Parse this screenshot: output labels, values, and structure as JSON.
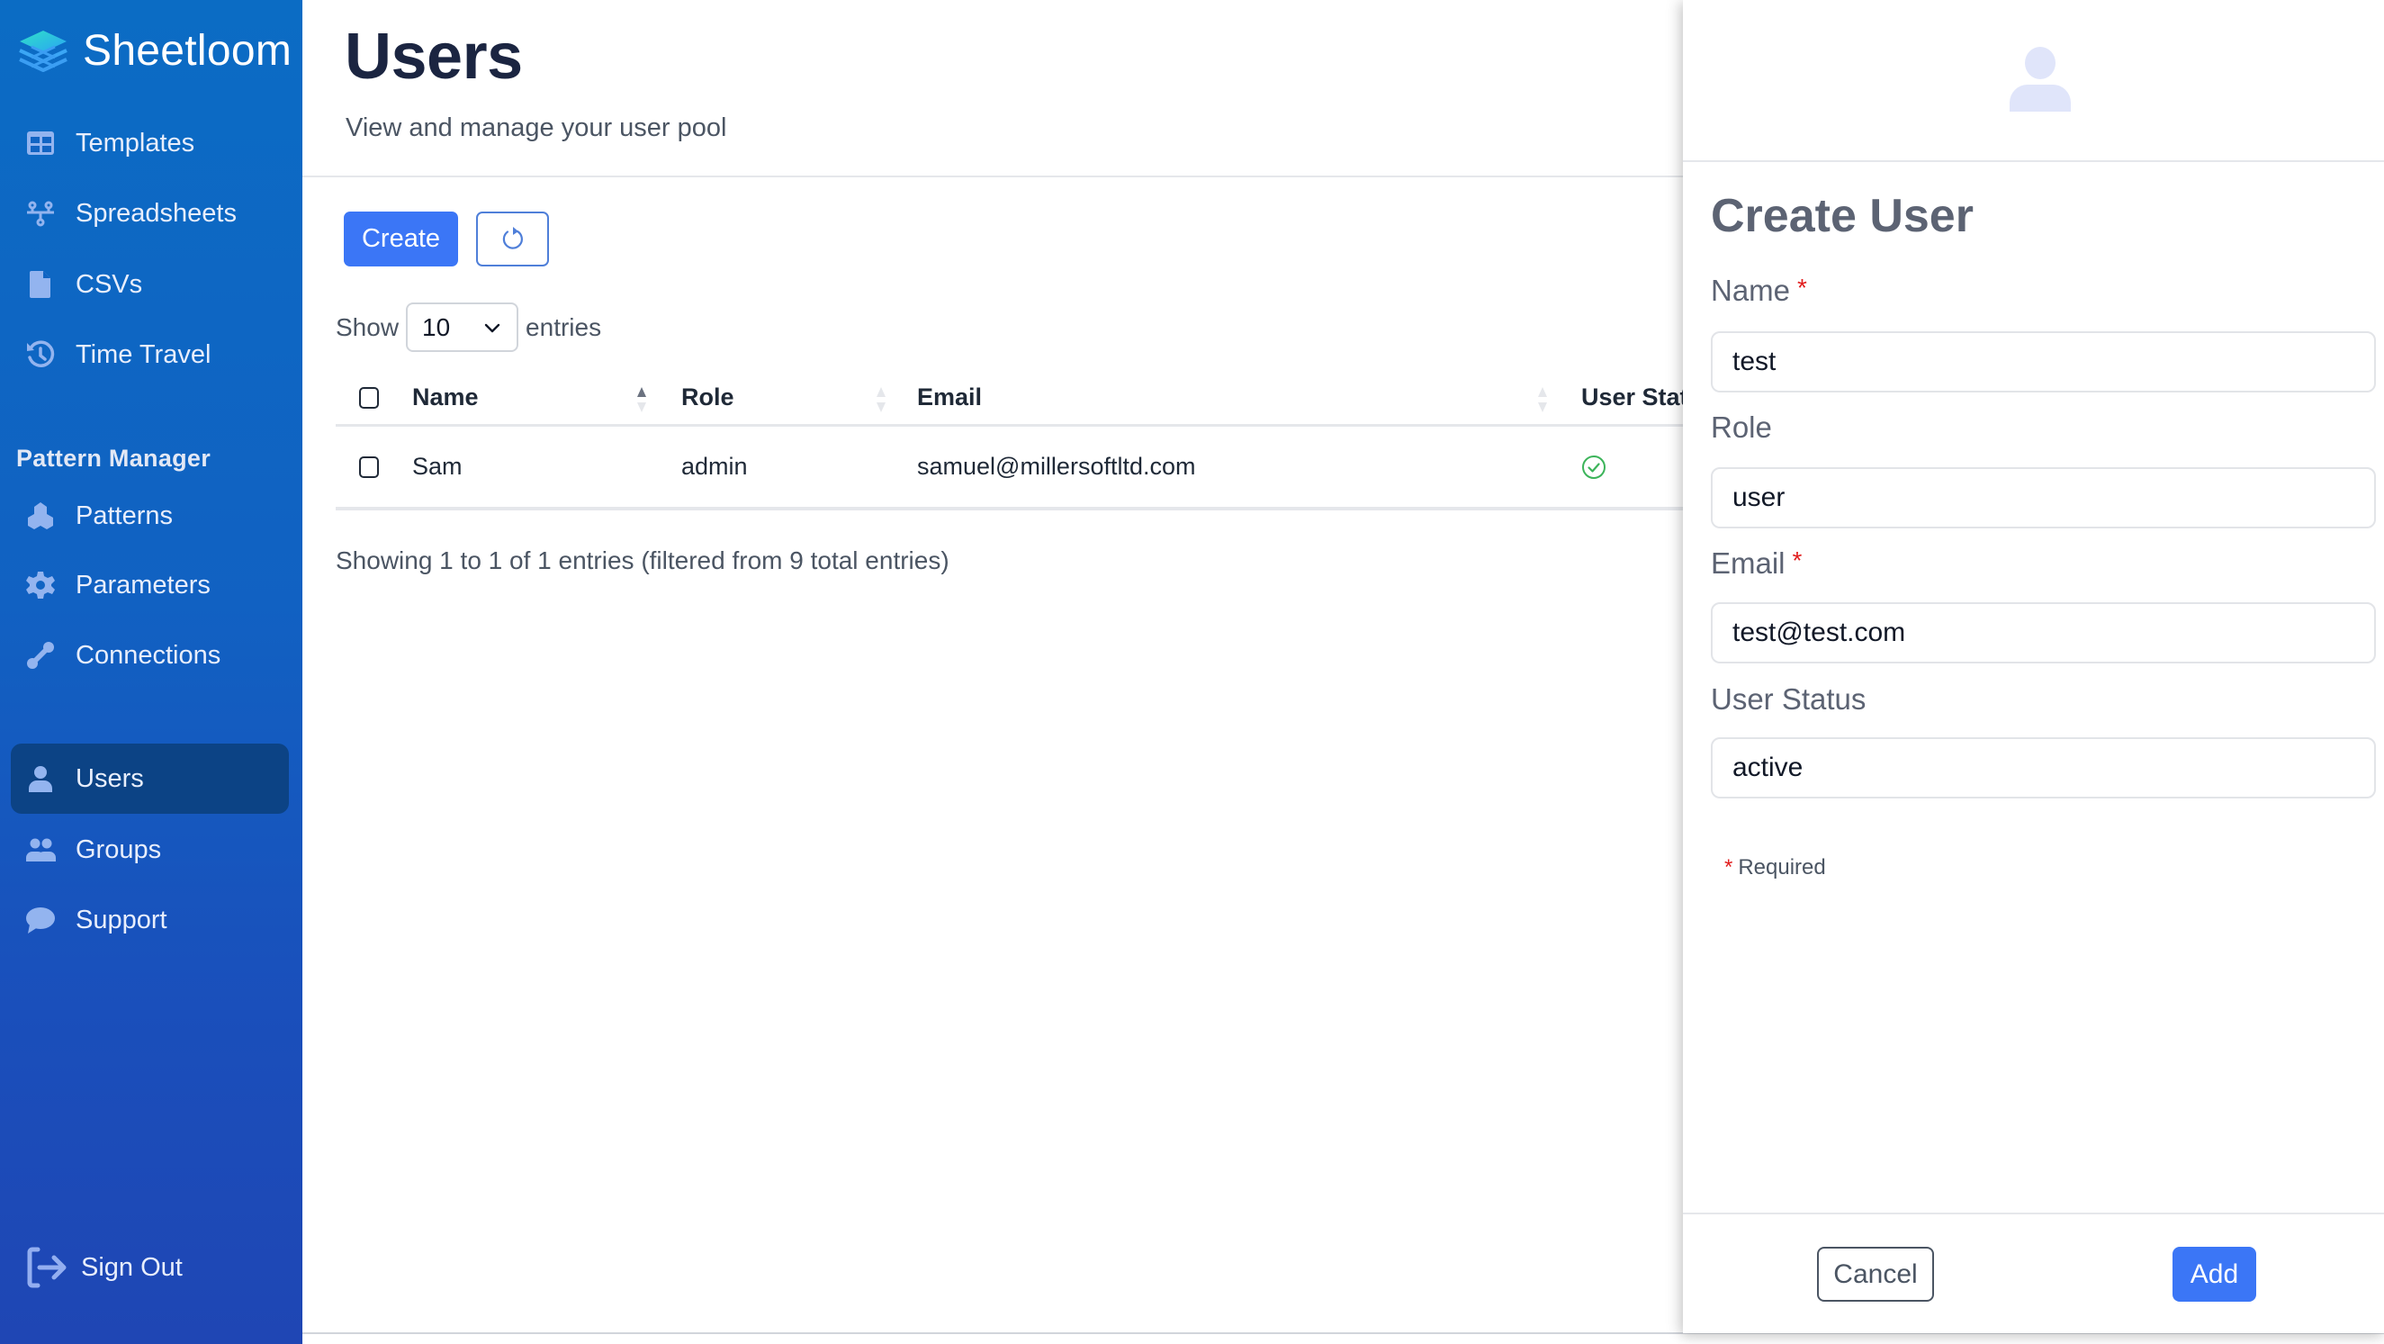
{
  "app": {
    "name": "Sheetloom",
    "logo_icon": "layered-grid-logo"
  },
  "sidebar": {
    "items": [
      {
        "label": "Templates",
        "icon": "table-grid-icon"
      },
      {
        "label": "Spreadsheets",
        "icon": "network-nodes-icon"
      },
      {
        "label": "CSVs",
        "icon": "file-icon"
      },
      {
        "label": "Time Travel",
        "icon": "history-icon"
      }
    ],
    "section_title": "Pattern Manager",
    "pattern_items": [
      {
        "label": "Patterns",
        "icon": "cubes-icon"
      },
      {
        "label": "Parameters",
        "icon": "gear-icon"
      },
      {
        "label": "Connections",
        "icon": "link-icon"
      }
    ],
    "admin_items": [
      {
        "label": "Users",
        "icon": "user-icon",
        "active": true
      },
      {
        "label": "Groups",
        "icon": "users-group-icon"
      },
      {
        "label": "Support",
        "icon": "chat-bubble-icon"
      }
    ],
    "sign_out": {
      "label": "Sign Out",
      "icon": "sign-out-icon"
    }
  },
  "page": {
    "title": "Users",
    "subtitle": "View and manage your user pool",
    "create_label": "Create",
    "refresh_icon": "refresh-icon"
  },
  "table_controls": {
    "show_label": "Show",
    "page_size": "10",
    "entries_label": "entries"
  },
  "table": {
    "columns": [
      "Name",
      "Role",
      "Email",
      "User Status"
    ],
    "rows": [
      {
        "name": "Sam",
        "role": "admin",
        "email": "samuel@millersoftltd.com",
        "status": "active",
        "status_icon": "check-circle-icon"
      }
    ],
    "summary": "Showing 1 to 1 of 1 entries (filtered from 9 total entries)"
  },
  "panel": {
    "title": "Create User",
    "avatar_icon": "user-avatar-icon",
    "fields": [
      {
        "label": "Name",
        "required": true,
        "value": "test"
      },
      {
        "label": "Role",
        "required": false,
        "value": "user"
      },
      {
        "label": "Email",
        "required": true,
        "value": "test@test.com"
      },
      {
        "label": "User Status",
        "required": false,
        "value": "active"
      }
    ],
    "required_mark": "*",
    "required_note": "Required",
    "cancel_label": "Cancel",
    "add_label": "Add"
  },
  "colors": {
    "primary": "#3b76f6",
    "sidebar_top": "#0b6cc4",
    "sidebar_bottom": "#1f46b4",
    "sidebar_active": "#0c4385",
    "success": "#3cb45a",
    "required": "#e11d1d"
  }
}
